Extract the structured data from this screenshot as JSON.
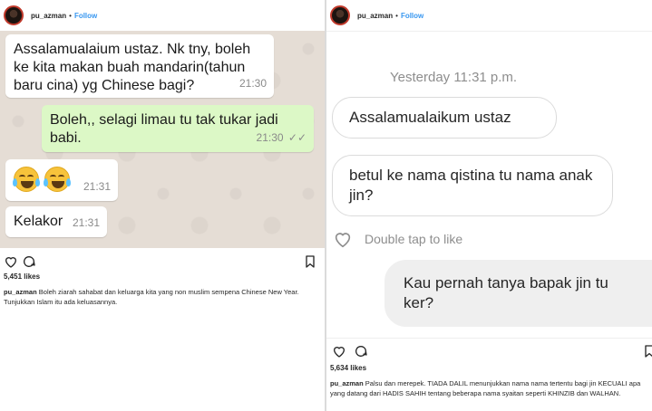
{
  "posts": [
    {
      "username": "pu_azman",
      "separator": "•",
      "follow_label": "Follow",
      "chat": {
        "messages": [
          {
            "direction": "in",
            "text": "Assalamualaium ustaz. Nk tny, boleh ke kita makan buah mandarin(tahun baru cina)  yg Chinese bagi?",
            "time": "21:30"
          },
          {
            "direction": "out",
            "text": "Boleh,, selagi limau tu tak tukar jadi babi.",
            "time": "21:30",
            "status": "✓✓"
          },
          {
            "direction": "in",
            "emoji": [
              "face-with-tears-of-joy",
              "face-with-tears-of-joy"
            ],
            "time": "21:31"
          },
          {
            "direction": "in",
            "text": "Kelakor",
            "time": "21:31"
          }
        ]
      },
      "likes": "5,451 likes",
      "caption": "Boleh ziarah sahabat dan keluarga kita yang non muslim sempena Chinese New Year. Tunjukkan Islam itu ada keluasannya."
    },
    {
      "username": "pu_azman",
      "separator": "•",
      "follow_label": "Follow",
      "chat": {
        "timestamp": "Yesterday 11:31 p.m.",
        "messages": [
          {
            "direction": "in",
            "text": "Assalamualaikum ustaz"
          },
          {
            "direction": "in",
            "text": "betul ke nama qistina tu nama anak jin?"
          },
          {
            "direction": "out",
            "text": "Kau pernah tanya bapak jin tu ker?"
          }
        ],
        "double_tap_label": "Double tap to like"
      },
      "likes": "5,634 likes",
      "caption": "Palsu dan merepek. TIADA DALIL menunjukkan nama nama tertentu bagi jin KECUALI apa yang datang dari HADIS SAHIH tentang beberapa nama syaitan seperti KHINZIB dan WALHAN."
    }
  ],
  "colors": {
    "follow_blue": "#3897f0",
    "wa_background": "#e5ddd5",
    "wa_outgoing": "#dcf8c6",
    "dm_sent": "#efefef"
  },
  "icons": [
    "heart-icon",
    "comment-icon",
    "bookmark-icon",
    "double-check-icon"
  ]
}
